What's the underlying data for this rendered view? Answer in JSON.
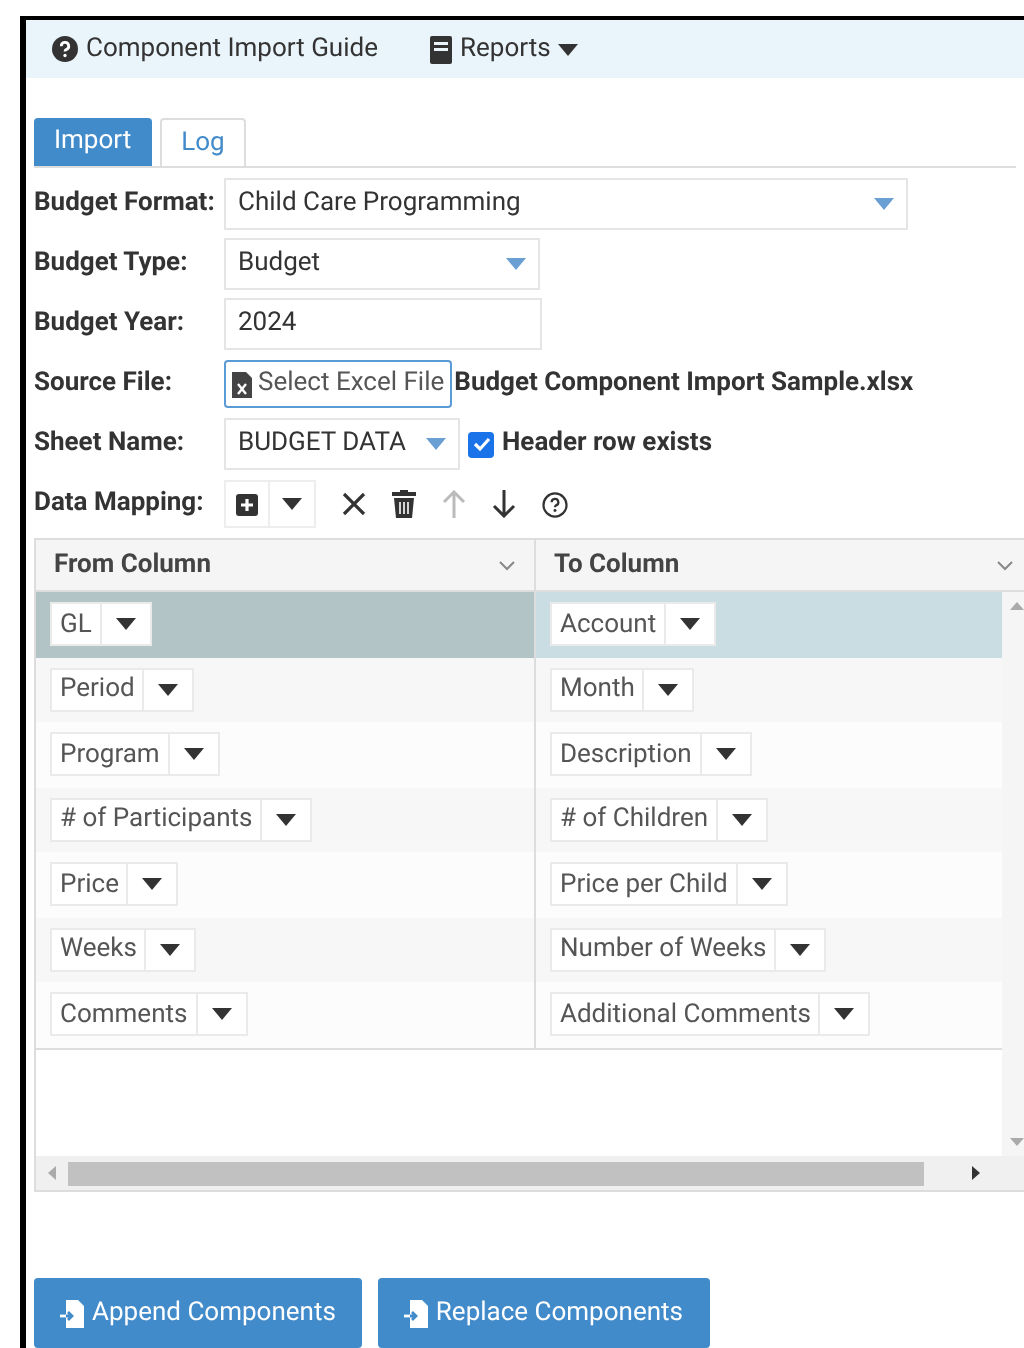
{
  "toolbar": {
    "guide": "Component Import Guide",
    "reports": "Reports"
  },
  "tabs": [
    {
      "label": "Import",
      "selected": true
    },
    {
      "label": "Log",
      "selected": false
    }
  ],
  "form": {
    "budget_format": {
      "label": "Budget Format:",
      "value": "Child Care Programming"
    },
    "budget_type": {
      "label": "Budget Type:",
      "value": "Budget"
    },
    "budget_year": {
      "label": "Budget Year:",
      "value": "2024"
    },
    "source_file": {
      "label": "Source File:",
      "button": "Select Excel File",
      "file_name": "Budget Component Import Sample.xlsx"
    },
    "sheet_name": {
      "label": "Sheet Name:",
      "value": "BUDGET DATA",
      "header_checkbox": {
        "label": "Header row exists",
        "checked": true
      }
    },
    "data_mapping": {
      "label": "Data Mapping:"
    }
  },
  "table": {
    "columns": [
      "From Column",
      "To Column"
    ],
    "rows": [
      {
        "from": "GL",
        "to": "Account",
        "selected": true
      },
      {
        "from": "Period",
        "to": "Month",
        "selected": false
      },
      {
        "from": "Program",
        "to": "Description",
        "selected": false
      },
      {
        "from": "# of Participants",
        "to": "# of Children",
        "selected": false
      },
      {
        "from": "Price",
        "to": "Price per Child",
        "selected": false
      },
      {
        "from": "Weeks",
        "to": "Number of Weeks",
        "selected": false
      },
      {
        "from": "Comments",
        "to": "Additional Comments",
        "selected": false
      }
    ]
  },
  "buttons": [
    "Append Components",
    "Replace Components"
  ]
}
